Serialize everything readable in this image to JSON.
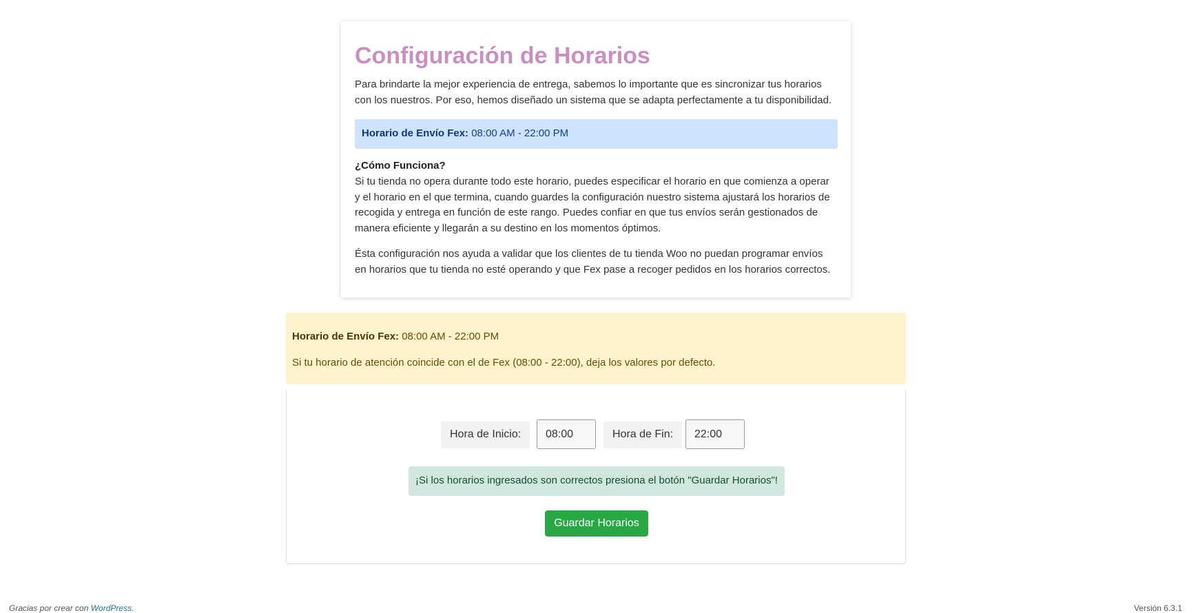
{
  "intro_card": {
    "title": "Configuración de Horarios",
    "intro": "Para brindarte la mejor experiencia de entrega, sabemos lo importante que es sincronizar tus horarios con los nuestros. Por eso, hemos diseñado un sistema que se adapta perfectamente a tu disponibilidad.",
    "schedule_label": "Horario de Envío Fex:",
    "schedule_value": "08:00 AM - 22:00 PM",
    "how_title": "¿Cómo Funciona?",
    "how_text": "Si tu tienda no opera durante todo este horario, puedes especificar el horario en que comienza a operar y el horario en el que termina, cuando guardes la configuración nuestro sistema ajustará los horarios de recogida y entrega en función de este rango. Puedes confiar en que tus envíos serán gestionados de manera eficiente y llegarán a su destino en los momentos óptimos.",
    "note_text": "Ésta configuración nos ayuda a validar que los clientes de tu tienda Woo no puedan programar envíos en horarios que tu tienda no esté operando y que Fex pase a recoger pedidos en los horarios correctos."
  },
  "warning": {
    "schedule_label": "Horario de Envío Fex:",
    "schedule_value": "08:00 AM - 22:00 PM",
    "message": "Si tu horario de atención coincide con el de Fex (08:00 - 22:00), deja los valores por defecto."
  },
  "form": {
    "start_label": "Hora de Inicio:",
    "start_value": "08:00",
    "end_label": "Hora de Fin:",
    "end_value": "22:00",
    "success_message": "¡Si los horarios ingresados son correctos presiona el botón \"Guardar Horarios\"!",
    "save_label": "Guardar Horarios"
  },
  "footer": {
    "thanks_prefix": "Gracias por crear con",
    "wordpress_link": "WordPress",
    "thanks_suffix": ".",
    "version": "Versión 6.3.1"
  },
  "colors": {
    "title": "#c98fc0",
    "info_bg": "#cfe2ff",
    "warning_bg": "#fff3cd",
    "success_bg": "#d1e7dd",
    "button_bg": "#28a745"
  }
}
